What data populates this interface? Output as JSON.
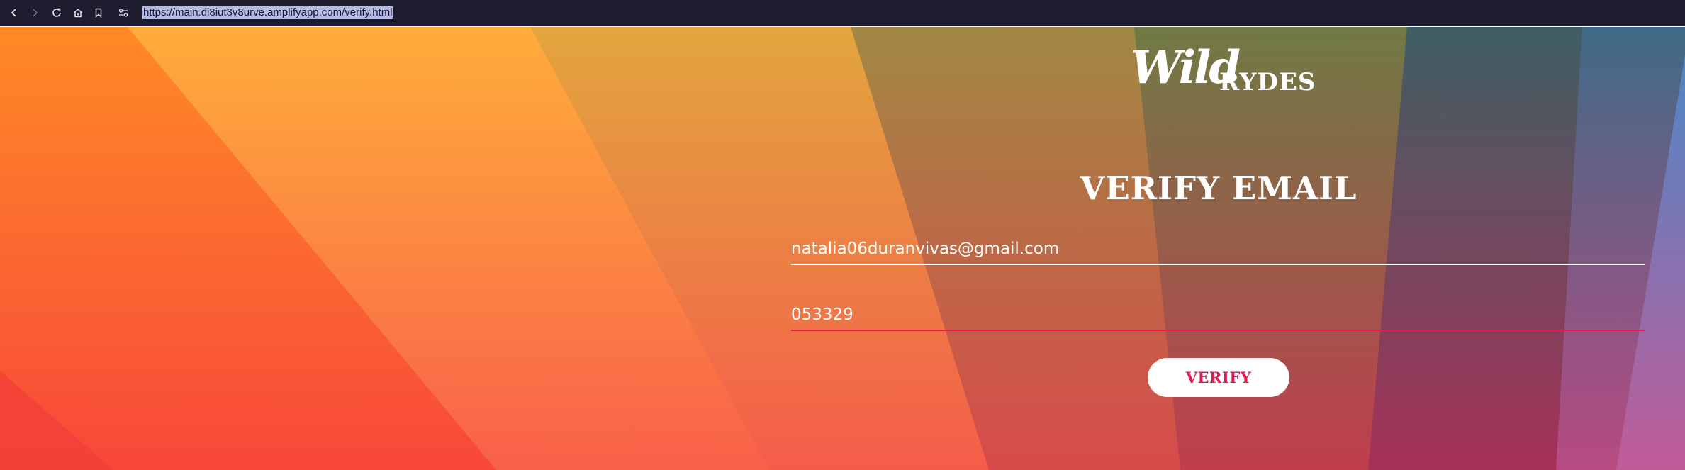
{
  "browser": {
    "url": "https://main.di8iut3v8urve.amplifyapp.com/verify.html",
    "icons": [
      "back-arrow-icon",
      "forward-arrow-icon",
      "reload-icon",
      "home-icon",
      "bookmark-icon",
      "site-info-icon"
    ]
  },
  "brand": {
    "wordmark_script": "Wild",
    "wordmark_caps": "RYDES"
  },
  "page": {
    "title": "VERIFY EMAIL"
  },
  "form": {
    "email_value": "natalia06duranvivas@gmail.com",
    "code_value": "053329",
    "submit_label": "VERIFY"
  },
  "colors": {
    "accent": "#e5194d",
    "toolbar_bg": "#1d1b2e",
    "text_on_hero": "#ffffff",
    "button_bg": "#ffffff"
  }
}
